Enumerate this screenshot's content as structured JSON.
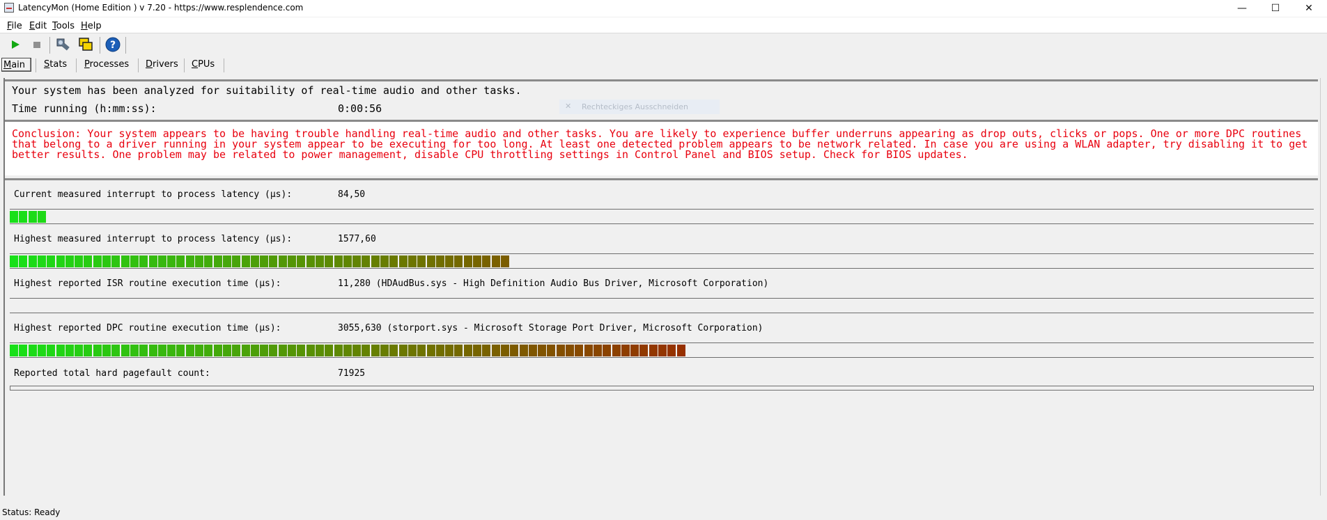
{
  "window": {
    "title": "LatencyMon  (Home Edition )  v 7.20 - https://www.resplendence.com",
    "minimize_glyph": "—",
    "maximize_glyph": "☐",
    "close_glyph": "✕"
  },
  "menu": {
    "file": {
      "key": "F",
      "rest": "ile"
    },
    "edit": {
      "key": "E",
      "rest": "dit"
    },
    "tools": {
      "key": "T",
      "rest": "ools"
    },
    "help": {
      "key": "H",
      "rest": "elp"
    }
  },
  "toolbar": {
    "icons": [
      "play-icon",
      "stop-icon",
      "tools-icon",
      "windows-icon",
      "help-icon"
    ],
    "colors": {
      "play": "#12a812",
      "stop": "#909090",
      "help": "#1c5fb8"
    }
  },
  "tabs": [
    {
      "key": "M",
      "rest": "ain",
      "active": true
    },
    {
      "key": "S",
      "rest": "tats"
    },
    {
      "key": "P",
      "rest": "rocesses"
    },
    {
      "key": "D",
      "rest": "rivers"
    },
    {
      "key": "C",
      "rest": "PUs"
    }
  ],
  "summary": {
    "headline": "Your system has been analyzed for suitability of real-time audio and other tasks.",
    "time_label": "Time running (h:mm:ss):",
    "time_value": "0:00:56"
  },
  "overlay": {
    "close_glyph": "✕",
    "label": "Rechteckiges Ausschneiden"
  },
  "conclusion": {
    "text": "Conclusion: Your system appears to be having trouble handling real-time audio and other tasks. You are likely to experience buffer underruns appearing as drop outs, clicks or pops. One or more DPC routines that belong to a driver running in your system appear to be executing for too long. At least one detected problem appears to be network related. In case you are using a WLAN adapter, try disabling it to get better results. One problem may be related to power management, disable CPU throttling settings in Control Panel and BIOS setup. Check for BIOS updates.",
    "color": "#e8000e"
  },
  "metrics": [
    {
      "label": "Current measured interrupt to process latency (µs):",
      "value": "84,50",
      "level": 0.025
    },
    {
      "label": "Highest measured interrupt to process latency (µs):",
      "value": "1577,60",
      "level": 0.385
    },
    {
      "label": "Highest reported ISR routine execution time (µs):",
      "value": "11,280  (HDAudBus.sys - High Definition Audio Bus Driver, Microsoft Corporation)",
      "level": 0
    },
    {
      "label": "Highest reported DPC routine execution time (µs):",
      "value": "3055,630  (storport.sys - Microsoft Storage Port Driver, Microsoft Corporation)",
      "level": 0.522
    },
    {
      "label": "Reported total hard pagefault count:",
      "value": "71925",
      "level": 0
    }
  ],
  "bar_colors": {
    "start": "#18e018",
    "mid": "#6a7a00",
    "end": "#9a2a00"
  },
  "status": {
    "text": "Status: Ready"
  }
}
